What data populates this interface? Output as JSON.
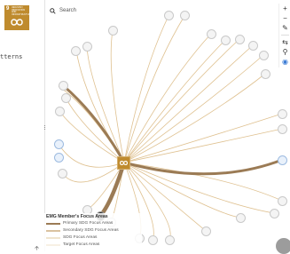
{
  "sidebar": {
    "badge_number": "9",
    "badge_text": "INDUSTRY, INNOVATION AND INFRASTRUCTURE",
    "partial_text": "tterns",
    "infinity_symbol": "∞",
    "corner_icon": "share-icon"
  },
  "search": {
    "label": "Search",
    "icon": "search-icon"
  },
  "toolbar": {
    "items": [
      {
        "label": "+",
        "name": "zoom-in-icon"
      },
      {
        "label": "−",
        "name": "zoom-out-icon"
      },
      {
        "label": "✎",
        "name": "pencil-icon"
      },
      {
        "label": "⇆",
        "name": "layout-icon"
      },
      {
        "label": "⚲",
        "name": "filter-icon"
      },
      {
        "label": "◉",
        "name": "locate-icon"
      }
    ]
  },
  "legend": {
    "title": "EMG Member's Focus Areas",
    "items": [
      {
        "label": "Primary SDG Focus Areas",
        "color": "#9b7b55"
      },
      {
        "label": "Secondary SDG Focus Areas",
        "color": "#c9a878"
      },
      {
        "label": "SDG Focus Areas",
        "color": "#e2c89c"
      },
      {
        "label": "Target Focus Areas",
        "color": "#efe2c8"
      }
    ]
  },
  "graph": {
    "center_color": "#bf8b2e",
    "edge_primary": "#9b7b55",
    "edge_secondary": "#dfc190"
  }
}
